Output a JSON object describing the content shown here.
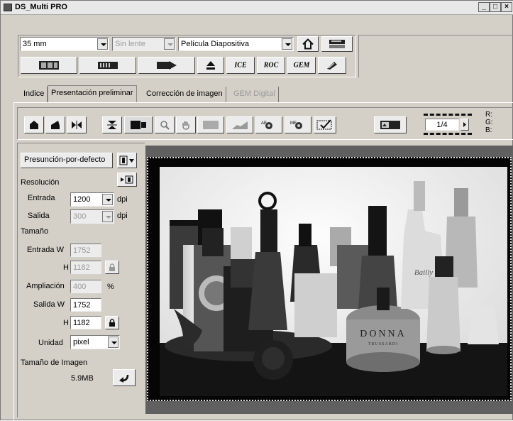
{
  "window": {
    "title": "DS_Multi PRO",
    "controls": [
      "_",
      "□",
      "×"
    ]
  },
  "toolbar": {
    "focal_value": "35 mm",
    "lens_value": "Sin lente",
    "film_value": "Película Diapositiva",
    "buttons": [
      "prescan-strip",
      "index-strip",
      "eject-forward",
      "eject",
      "ICE",
      "ROC",
      "GEM",
      "auto-adjust"
    ],
    "ice_label": "ICE",
    "roc_label": "ROC",
    "gem_label": "GEM"
  },
  "tabs": [
    {
      "label": "Indice"
    },
    {
      "label": "Presentación preliminar"
    },
    {
      "label": "Corrección de imagen"
    },
    {
      "label": "GEM Digital"
    }
  ],
  "preview_toolbar": {
    "frame_counter": "1/4",
    "rgb_labels": [
      "R:",
      "G:",
      "B:"
    ]
  },
  "settings": {
    "preset_label": "Presunción-por-defecto",
    "resolution_heading": "Resolución",
    "input_label": "Entrada",
    "input_value": "1200",
    "input_unit": "dpi",
    "output_label": "Salida",
    "output_value": "300",
    "output_unit": "dpi",
    "size_heading": "Tamaño",
    "input_w_label": "Entrada W",
    "input_w_value": "1752",
    "input_h_label": "H",
    "input_h_value": "1182",
    "zoom_label": "Ampliación",
    "zoom_value": "400",
    "zoom_unit": "%",
    "output_w_label": "Salida W",
    "output_w_value": "1752",
    "output_h_label": "H",
    "output_h_value": "1182",
    "unit_label": "Unidad",
    "unit_value": "pixel",
    "image_size_label": "Tamaño de Imagen",
    "image_size_value": "5.9MB"
  },
  "preview": {
    "bottle_text_line1": "DONNA",
    "bottle_text_line2": "TRUSSARDI",
    "script_text": "Bailly"
  }
}
